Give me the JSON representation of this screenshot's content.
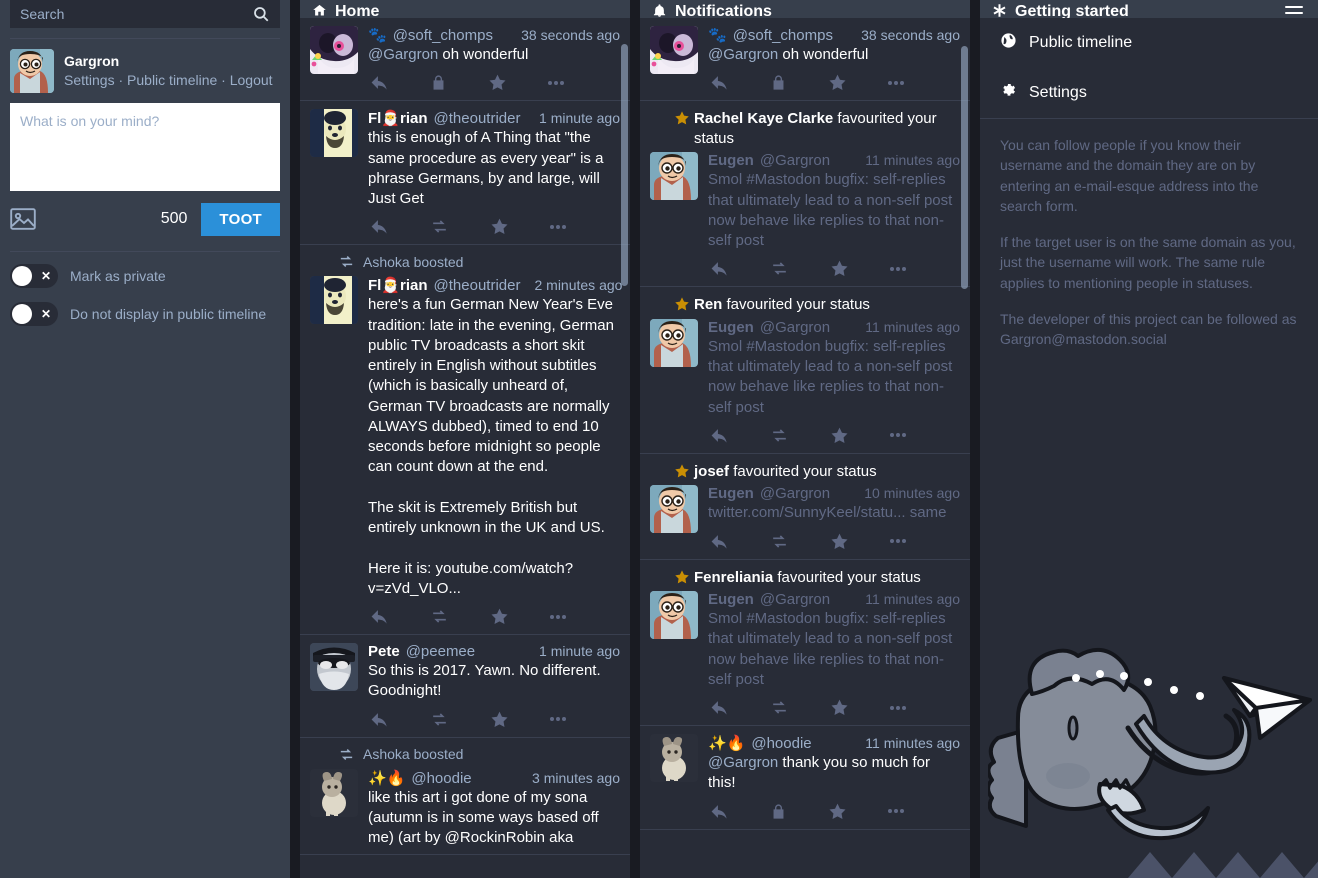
{
  "theme": {
    "bg": "#191b22",
    "column_bg": "#282c37",
    "header_bg": "#373f4c",
    "accent": "#2b90d9",
    "muted_text": "#9baec8",
    "dim_text": "#606984",
    "star_gold": "#ca8f04"
  },
  "drawer": {
    "search": {
      "placeholder": "Search",
      "value": "",
      "icon": "search-icon"
    },
    "account": {
      "name": "Gargron",
      "links": [
        "Settings",
        "Public timeline",
        "Logout"
      ],
      "links_joined": "Settings · Public timeline · Logout"
    },
    "composer": {
      "placeholder": "What is on your mind?",
      "value": "",
      "char_count": "500",
      "toot_label": "TOOT",
      "upload_icon": "image-upload-icon"
    },
    "toggles": [
      {
        "label": "Mark as private",
        "on": false,
        "icon": "x-icon"
      },
      {
        "label": "Do not display in public timeline",
        "on": false,
        "icon": "x-icon"
      }
    ]
  },
  "columns": [
    {
      "id": "home",
      "title": "Home",
      "icon": "home-icon",
      "statuses": [
        {
          "boost_by": null,
          "display_name": "",
          "emoji_prefix": "🐾",
          "handle": "@soft_chomps",
          "timestamp": "38 seconds ago",
          "content": "@Gargron oh wonderful",
          "mention_prefix": "@Gargron",
          "content_rest": " oh wonderful",
          "avatar": "avatar-soft-chomps",
          "visibility": "private",
          "actions": [
            "reply-icon",
            "lock-icon",
            "star-icon",
            "more-icon"
          ]
        },
        {
          "boost_by": null,
          "display_name": "Fl🎅rian",
          "handle": "@theoutrider",
          "timestamp": "1 minute ago",
          "content": "this is enough of A Thing that \"the same procedure as every year\" is a phrase Germans, by and large, will Just Get",
          "avatar": "avatar-theoutrider",
          "visibility": "public",
          "actions": [
            "reply-icon",
            "boost-icon",
            "star-icon",
            "more-icon"
          ]
        },
        {
          "boost_by": "Ashoka boosted",
          "display_name": "Fl🎅rian",
          "handle": "@theoutrider",
          "timestamp": "2 minutes ago",
          "content": "here's a fun German New Year's Eve tradition: late in the evening, German public TV broadcasts a short skit entirely in English without subtitles (which is basically unheard of, German TV broadcasts are normally ALWAYS dubbed), timed to end 10 seconds before midnight so people can count down at the end.\n\nThe skit is Extremely British but entirely unknown in the UK and US.\n\nHere it is: youtube.com/watch?v=zVd_VLO...",
          "avatar": "avatar-theoutrider",
          "visibility": "public",
          "actions": [
            "reply-icon",
            "boost-icon",
            "star-icon",
            "more-icon"
          ]
        },
        {
          "boost_by": null,
          "display_name": "Pete",
          "handle": "@peemee",
          "timestamp": "1 minute ago",
          "content": "So this is 2017. Yawn. No different. Goodnight!",
          "avatar": "avatar-peemee",
          "visibility": "public",
          "actions": [
            "reply-icon",
            "boost-icon",
            "star-icon",
            "more-icon"
          ]
        },
        {
          "boost_by": "Ashoka boosted",
          "display_name": "✨🔥",
          "handle": "@hoodie",
          "timestamp": "3 minutes ago",
          "content": "like this art i got done of my sona (autumn is in some ways based off me) (art by @RockinRobin aka",
          "avatar": "avatar-hoodie",
          "visibility": "public",
          "actions": []
        }
      ]
    },
    {
      "id": "notifications",
      "title": "Notifications",
      "icon": "bell-icon",
      "items": [
        {
          "type": "mention",
          "emoji_prefix": "🐾",
          "handle": "@soft_chomps",
          "timestamp": "38 seconds ago",
          "mention_prefix": "@Gargron",
          "content_rest": " oh wonderful",
          "avatar": "avatar-soft-chomps",
          "actions": [
            "reply-icon",
            "lock-icon",
            "star-icon",
            "more-icon"
          ]
        },
        {
          "type": "favourite",
          "actor": "Rachel Kaye Clarke",
          "action_text": "favourited your status",
          "display_name": "Eugen",
          "handle": "@Gargron",
          "timestamp": "11 minutes ago",
          "content": "Smol #Mastodon bugfix: self-replies that ultimately lead to a non-self post now behave like replies to that non-self post",
          "avatar": "avatar-gargron",
          "actions": [
            "reply-icon",
            "boost-icon",
            "star-icon",
            "more-icon"
          ]
        },
        {
          "type": "favourite",
          "actor": "Ren",
          "action_text": "favourited your status",
          "display_name": "Eugen",
          "handle": "@Gargron",
          "timestamp": "11 minutes ago",
          "content": "Smol #Mastodon bugfix: self-replies that ultimately lead to a non-self post now behave like replies to that non-self post",
          "avatar": "avatar-gargron",
          "actions": [
            "reply-icon",
            "boost-icon",
            "star-icon",
            "more-icon"
          ]
        },
        {
          "type": "favourite",
          "actor": "josef",
          "action_text": "favourited your status",
          "display_name": "Eugen",
          "handle": "@Gargron",
          "timestamp": "10 minutes ago",
          "content": "twitter.com/SunnyKeel/statu... same",
          "avatar": "avatar-gargron",
          "actions": [
            "reply-icon",
            "boost-icon",
            "star-icon",
            "more-icon"
          ]
        },
        {
          "type": "favourite",
          "actor": "Fenreliania",
          "action_text": "favourited your status",
          "display_name": "Eugen",
          "handle": "@Gargron",
          "timestamp": "11 minutes ago",
          "content": "Smol #Mastodon bugfix: self-replies that ultimately lead to a non-self post now behave like replies to that non-self post",
          "avatar": "avatar-gargron",
          "actions": [
            "reply-icon",
            "boost-icon",
            "star-icon",
            "more-icon"
          ]
        },
        {
          "type": "mention",
          "emoji_prefix": "✨🔥",
          "handle": "@hoodie",
          "timestamp": "11 minutes ago",
          "mention_prefix": "@Gargron",
          "content_rest": " thank you so much for this!",
          "avatar": "avatar-hoodie",
          "actions": [
            "reply-icon",
            "lock-icon",
            "star-icon",
            "more-icon"
          ]
        }
      ]
    }
  ],
  "right_panel": {
    "title": "Getting started",
    "icon": "asterisk-icon",
    "menu_icon": "hamburger-icon",
    "items": [
      {
        "label": "Public timeline",
        "icon": "globe-icon"
      },
      {
        "label": "Settings",
        "icon": "gear-icon"
      }
    ],
    "paragraphs": [
      "You can follow people if you know their username and the domain they are on by entering an e-mail-esque address into the search form.",
      "If the target user is on the same domain as you, just the username will work. The same rule applies to mentioning people in statuses.",
      "The developer of this project can be followed as Gargron@mastodon.social"
    ],
    "mascot": "mastodon-elephant-illustration"
  }
}
